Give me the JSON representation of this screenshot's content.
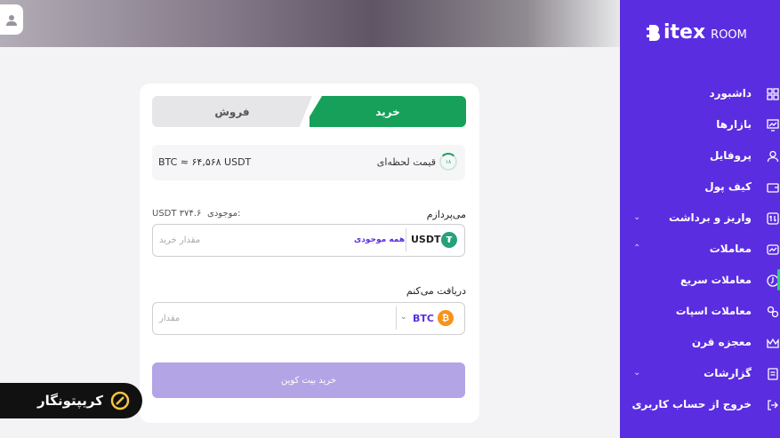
{
  "trade": {
    "tabs": {
      "buy": "خرید",
      "sell": "فروش"
    },
    "price": {
      "label": "قیمت لحظه‌ای",
      "value": "BTC ≈ ۶۴,۵۶۸ USDT",
      "timer": "۱۸"
    },
    "pay": {
      "label": "می‌پردازم",
      "balance_label": "موجودی:",
      "balance_value": "USDT ۳۷۴.۶",
      "currency": "USDT",
      "all_balance": "همه موجودی",
      "placeholder": "مقدار خرید"
    },
    "receive": {
      "label": "دریافت می‌کنم",
      "currency": "BTC",
      "placeholder": "مقدار"
    },
    "submit": "خرید بیت کوین"
  },
  "sidebar": {
    "logo_main": "itex",
    "logo_sub": "ROOM",
    "items": [
      {
        "label": "داشبورد",
        "icon": "grid-icon"
      },
      {
        "label": "بازارها",
        "icon": "chart-icon"
      },
      {
        "label": "پروفایل",
        "icon": "user-icon"
      },
      {
        "label": "کیف پول",
        "icon": "wallet-icon"
      },
      {
        "label": "واریز و برداشت",
        "icon": "transfer-icon",
        "chevron": "down"
      },
      {
        "label": "معاملات",
        "icon": "trade-icon",
        "chevron": "up"
      },
      {
        "label": "معاملات سریع",
        "icon": "quick-trade-icon"
      },
      {
        "label": "معاملات اسپات",
        "icon": "spot-icon"
      },
      {
        "label": "معجزه قرن",
        "icon": "crown-icon"
      },
      {
        "label": "گزارشات",
        "icon": "report-icon",
        "chevron": "down"
      },
      {
        "label": "خروج از حساب کاربری",
        "icon": "logout-icon"
      }
    ]
  },
  "watermark": {
    "text": "کریپتونگار"
  },
  "colors": {
    "brand": "#5b2de0",
    "buy": "#16a05a",
    "submit": "#b3a4e6"
  }
}
